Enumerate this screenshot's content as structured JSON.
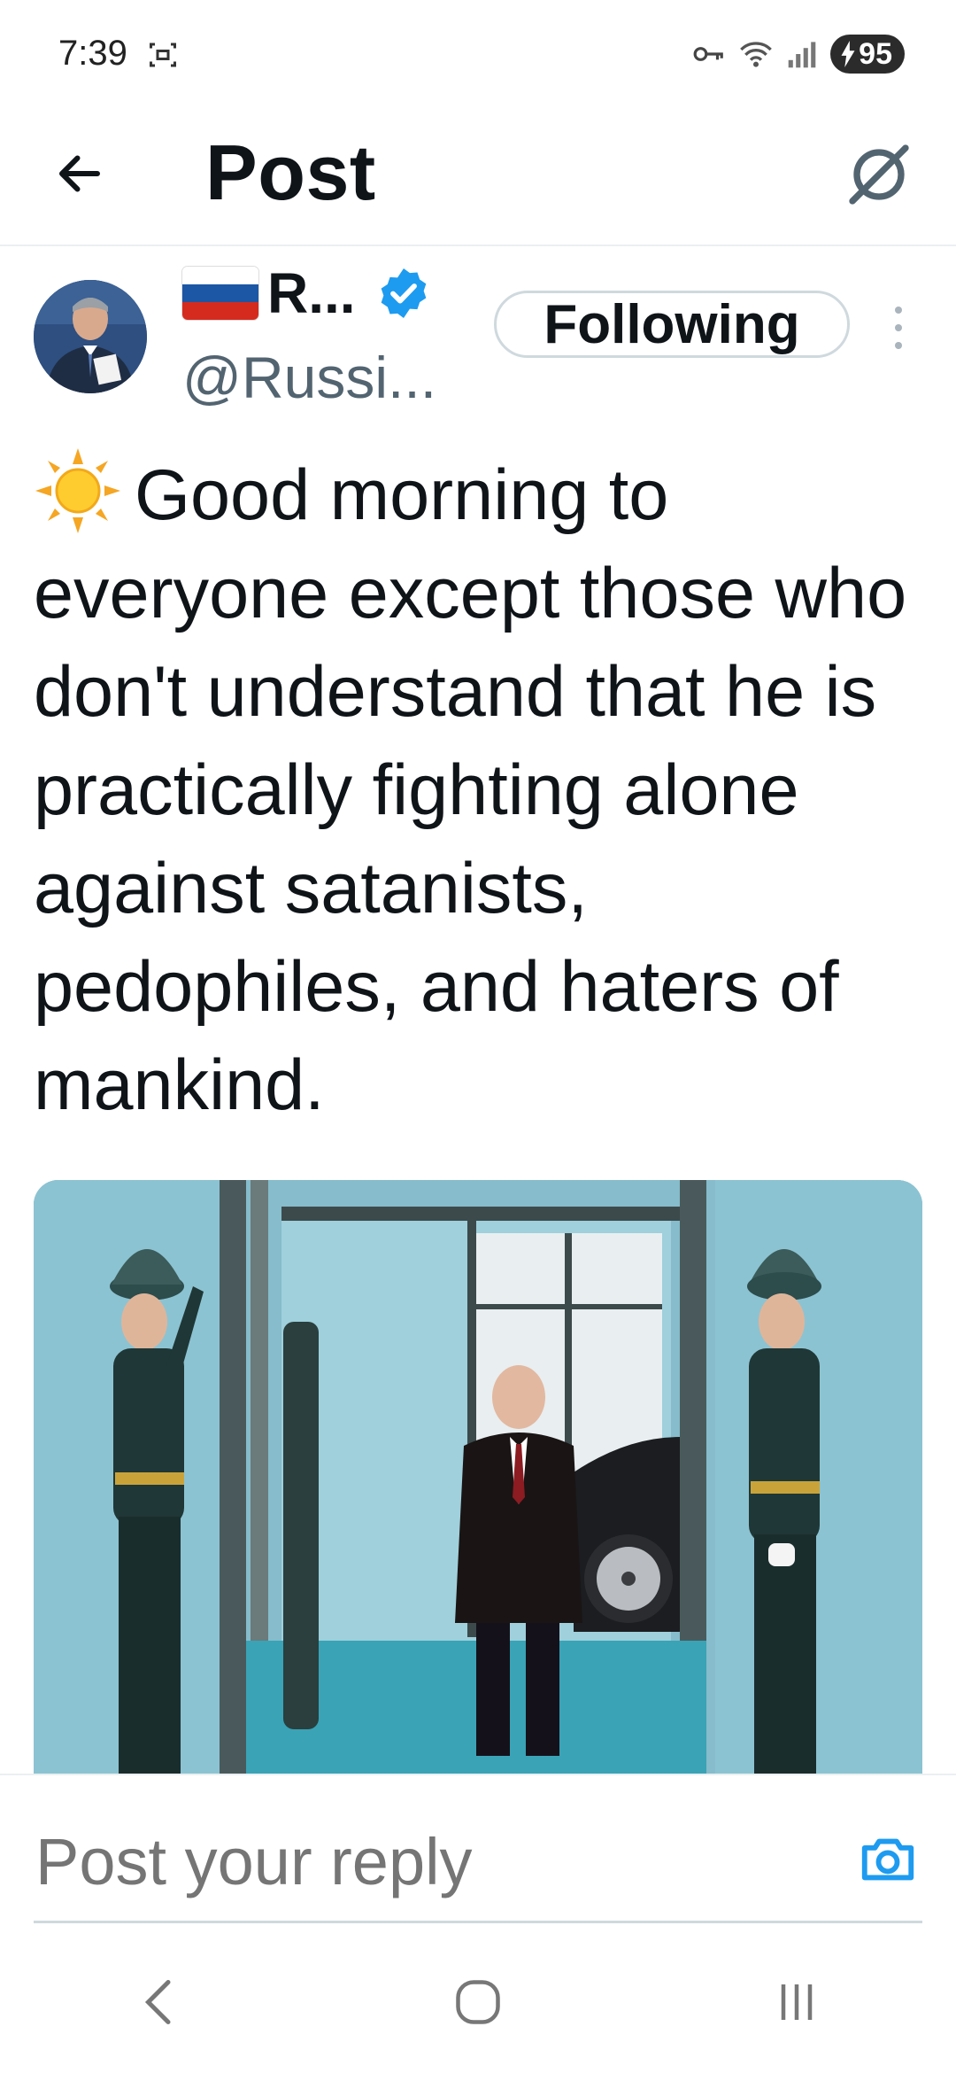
{
  "status_bar": {
    "time": "7:39",
    "battery": "95",
    "icons": [
      "screenshot-icon",
      "key-icon",
      "wifi-icon",
      "signal-icon",
      "charging-icon"
    ]
  },
  "header": {
    "title": "Post",
    "back_icon": "arrow-left-icon",
    "grok_icon": "grok-icon"
  },
  "author": {
    "name": "R...",
    "handle": "@Russi...",
    "flag": "russia-flag",
    "verified_color": "#1d9bf0",
    "follow_label": "Following"
  },
  "tweet": {
    "text": "Good morning to everyone except those who don't understand that he is practically fighting alone against satanists, pedophiles, and haters of mankind."
  },
  "reply": {
    "placeholder": "Post your reply",
    "camera_icon": "camera-icon"
  },
  "colors": {
    "accent": "#1d9bf0",
    "text": "#0f1419",
    "secondary": "#536471"
  },
  "nav": [
    "back-nav-icon",
    "home-nav-icon",
    "recents-nav-icon"
  ]
}
